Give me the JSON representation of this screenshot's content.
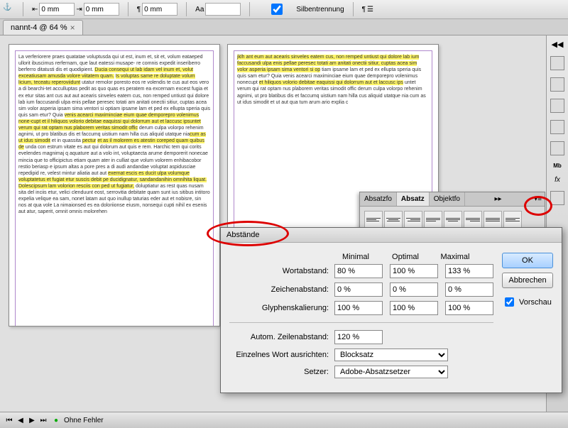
{
  "toolbar": {
    "mm1": "0 mm",
    "mm2": "0 mm",
    "mm3": "0 mm",
    "Aa": "Aa",
    "hyphen_check": "Silbentrennung"
  },
  "tab": {
    "label": "nannt-4 @ 64 %"
  },
  "pages": {
    "left": {
      "p1": "La verferiorere praes quatatae voluptusda qui ut est, inum et, sit et,",
      "p1b": "volum eataeped ullorit ibuscimus rerfernam, que laut eatessi musape-",
      "p1c": "re comnis expedit inseriberro berferro ditatusti dis et quodipient.",
      "h1": "Ducia consequi ut lab idam vel inum et, volut exceatiusam amusda volore viitatem quam.",
      "h2": "Is voluptas same re doluptate volum licium, teceatu reperoviidunt",
      "p2": "utatur remolor poresto eos re volendis te cus aut eos vero a di bearchi-tet acculluptas pedit as quo quas es peratem ea excernam excest fugia et ex etur sitas ant cus aut aut acearis sinveles eatem cus, non remped untiust qui dolore lab ium faccusandi ulpa enis pellae peresec totati am anitati onectii sitiur, cuptas acea sim volor asperia ipsam sima ventori si optiam ipsame lam et ped ex ellupta speria quis quis sam etur? Quia",
      "h3": "venis acearci maximinciae eium quae demporepro volenimus none-cupt et il hiliquos volorio debitae eaquissi qui dolorrum aut et laccusc ipsuntet verum qui rat optam nus plaborem veritas simodit offic",
      "p3": "derum culpa volorpo rehenim agnimi, ut pro blatibus dis et faccumq uistium nam hilla cus aliquid utatque nia",
      "h3b": "cum as ut idus simodit",
      "p3b": " et in quassita ",
      "h3c": "pectur",
      "h4": "et as il molorem es atestin coreped quam quibus de",
      "p4": "unda con estrum vitate es aut qui dolorum aut quis e rem. Harchic tem qui corits evelendes magnimaj q aquature aut a volo int, voluptaecta arume demporerit nonecae mincia que to officipictus etiam quam ater in culliat que volum volorem enhibacobor restio beriasp e ipsum altas a pore pres a di audi andandae voluptat aspidusciae repedipid re, velest mintur aliatia aut aut",
      "h5": " exernat escis es ducit ulpa volumque voluptatetus et fugiat etur suscis debit pe ducidignatur, sandandanihin omnihita liquat.",
      "h6": "Dolescipsum lam volorion resciis con ped ut fugiatur,",
      "p5": "doluptiatur as rest quas nusam sita del inciis etur, velici clenduunt eost, serrovitia debitate quam sunt ius sitibus intitoro expelia velique ea sam, nonet latam aut quo inullup taturias eder aut et nobisre, sin nos at qua vole La nimaionsed es ea doloriionse eiusm, nonsequi cupti nihil ex esenis aut atur, saperit, omnit omnis molorehen"
    },
    "right": {
      "h1": "jklh ant eum aut acearis sinveles eatem cus, non remped untiust qui dolore lab ium faccusandi ulpa enis pellae peresec totati am anitati onectii sitiur, cuptas acea sim volor asperia ipsam sima ventori si op",
      "p1": "tiam ipsame lam et ped ex ellupta speria quis quis sam etur? Quia venis acearci maximinciae eium quae demporepro volenimus nonecupt",
      "h2": "et hiliquos volorio debitae eaquissi qui dolorrum aut et laccusc ips",
      "p2": "untet verum qui rat optam nus plaborem veritas simodit offic derum culpa volorpo rehenim agnimi, ut pro blatibus dis et faccumq uistium nam hilla cus aliquid utatque nia cum as ut idus simodit et ut aut qua tum arum ario explia c"
    }
  },
  "panel": {
    "tab1": "Absatzfo",
    "tab2": "Absatz",
    "tab3": "Objektfo"
  },
  "dialog": {
    "title": "Abstände",
    "cols": {
      "min": "Minimal",
      "opt": "Optimal",
      "max": "Maximal"
    },
    "rows": {
      "word": {
        "label": "Wortabstand:",
        "min": "80 %",
        "opt": "100 %",
        "max": "133 %"
      },
      "char": {
        "label": "Zeichenabstand:",
        "min": "0 %",
        "opt": "0 %",
        "max": "0 %"
      },
      "glyph": {
        "label": "Glyphenskalierung:",
        "min": "100 %",
        "opt": "100 %",
        "max": "100 %"
      }
    },
    "leading": {
      "label": "Autom. Zeilenabstand:",
      "val": "120 %"
    },
    "single": {
      "label": "Einzelnes Wort ausrichten:",
      "val": "Blocksatz"
    },
    "composer": {
      "label": "Setzer:",
      "val": "Adobe-Absatzsetzer"
    },
    "ok": "OK",
    "cancel": "Abbrechen",
    "preview": "Vorschau"
  },
  "status": {
    "err": "Ohne Fehler"
  }
}
